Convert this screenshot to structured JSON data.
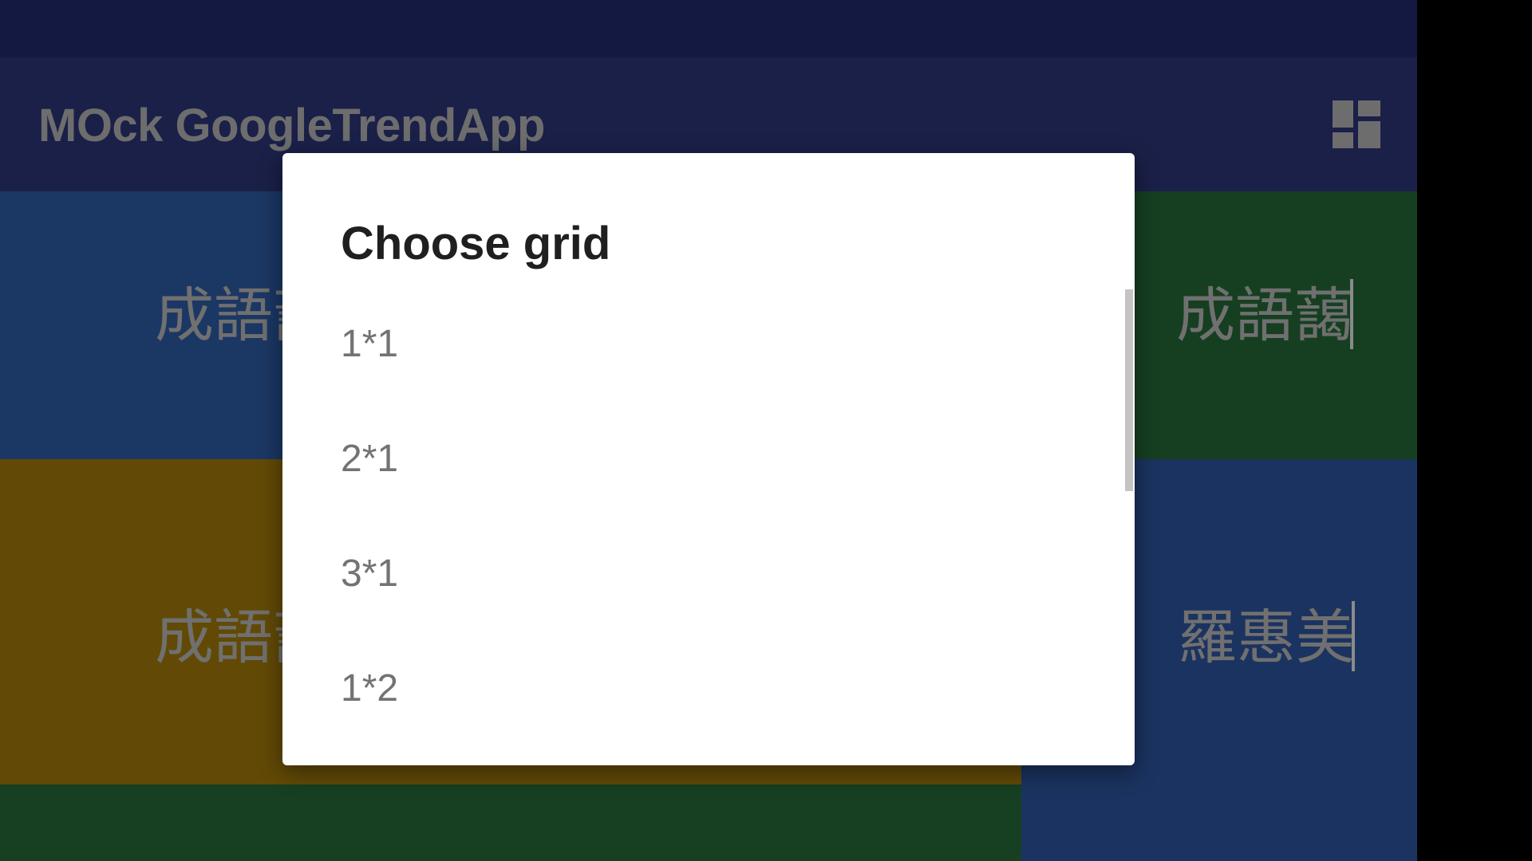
{
  "app_bar": {
    "title": "MOck GoogleTrendApp",
    "action_icon": "dashboard-icon"
  },
  "tiles": [
    {
      "text": "成語藹",
      "color": "#1b3764"
    },
    {
      "text": "成語藹",
      "color": "#163f22"
    },
    {
      "text": "成語藹",
      "color": "#624a06"
    },
    {
      "text": "羅惠美",
      "color": "#1b3360"
    },
    {
      "text": "",
      "color": "#173f22"
    }
  ],
  "dialog": {
    "title": "Choose grid",
    "options": [
      "1*1",
      "2*1",
      "3*1",
      "1*2"
    ]
  },
  "colors": {
    "status_bar": "#131940",
    "app_bar": "#1a2048",
    "dialog_background": "#ffffff"
  }
}
